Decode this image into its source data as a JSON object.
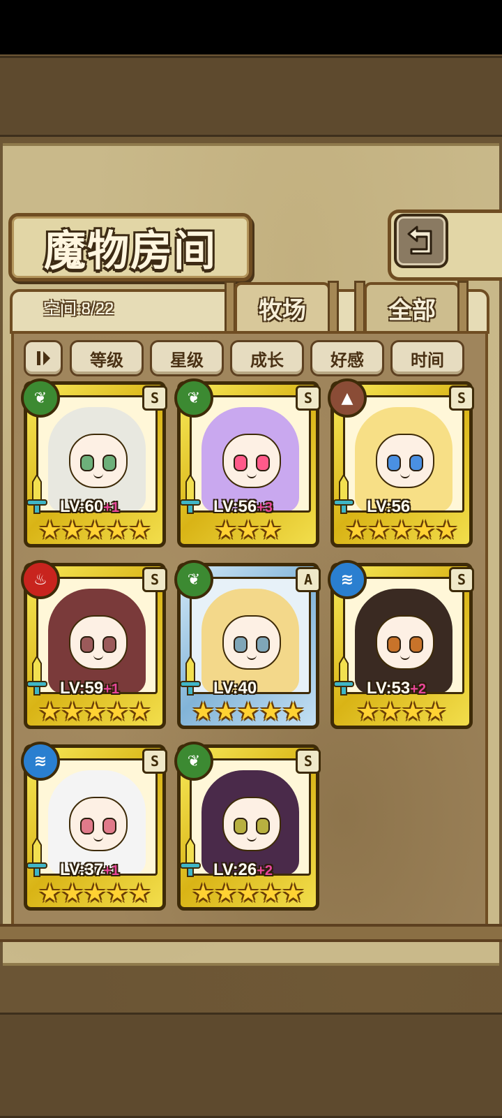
{
  "title": "魔物房间",
  "space_label": "空间:8/22",
  "tabs": [
    {
      "label": "牧场",
      "active": true
    },
    {
      "label": "全部",
      "active": false
    }
  ],
  "sort_buttons": [
    "等级",
    "星级",
    "成长",
    "好感",
    "时间"
  ],
  "cards": [
    {
      "element": "earth",
      "rank": "S",
      "frame": "gold",
      "level": "LV:60",
      "bonus": "+1",
      "stars": 5,
      "hair": "#e8e8e0",
      "eyes": "#6db07a"
    },
    {
      "element": "earth",
      "rank": "S",
      "frame": "gold",
      "level": "LV:56",
      "bonus": "+3",
      "stars": 3,
      "hair": "#c9a8ef",
      "eyes": "#ff5a8a"
    },
    {
      "element": "rock",
      "rank": "S",
      "frame": "gold",
      "level": "LV:56",
      "bonus": "",
      "stars": 5,
      "hair": "#f7df86",
      "eyes": "#4a90e2"
    },
    {
      "element": "fire",
      "rank": "S",
      "frame": "gold",
      "level": "LV:59",
      "bonus": "+1",
      "stars": 5,
      "hair": "#7a3a3a",
      "eyes": "#9b5a5a"
    },
    {
      "element": "earth",
      "rank": "A",
      "frame": "blue",
      "level": "LV:40",
      "bonus": "",
      "stars": 5,
      "hair": "#f3d88a",
      "eyes": "#7fa6b8"
    },
    {
      "element": "water",
      "rank": "S",
      "frame": "gold",
      "level": "LV:53",
      "bonus": "+2",
      "stars": 4,
      "hair": "#3a2a22",
      "eyes": "#c8732a"
    },
    {
      "element": "water",
      "rank": "S",
      "frame": "gold",
      "level": "LV:37",
      "bonus": "+1",
      "stars": 5,
      "hair": "#f4f4f4",
      "eyes": "#e07a8a"
    },
    {
      "element": "earth",
      "rank": "S",
      "frame": "gold",
      "level": "LV:26",
      "bonus": "+2",
      "stars": 5,
      "hair": "#4a2a4a",
      "eyes": "#b8b040"
    }
  ],
  "icons": {
    "back": "back-arrow-icon",
    "sort_toggle": "sort-order-icon",
    "earth": "leaf-icon",
    "fire": "flame-icon",
    "water": "wave-icon",
    "rock": "rock-icon",
    "weapon": "sword-icon"
  },
  "colors": {
    "gold_frame": "#d9b416",
    "blue_frame": "#82b4d8",
    "bonus_text": "#e8479a",
    "star": "#ffd233"
  }
}
